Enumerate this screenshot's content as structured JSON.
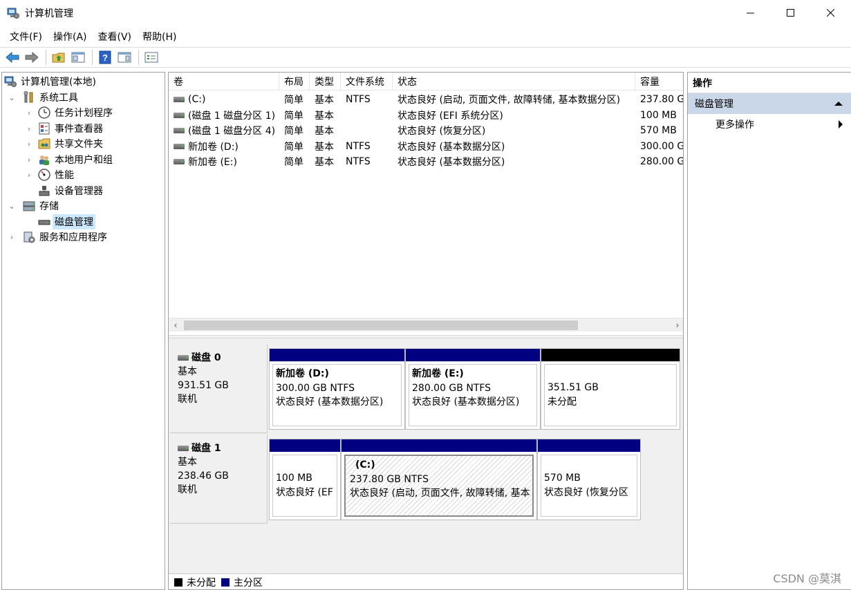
{
  "window": {
    "title": "计算机管理",
    "controls": [
      "minimize-icon",
      "maximize-icon",
      "close-icon"
    ]
  },
  "menu": [
    "文件(F)",
    "操作(A)",
    "查看(V)",
    "帮助(H)"
  ],
  "toolbar": {
    "buttons": [
      "back-arrow-icon",
      "forward-arrow-icon",
      "up-folder-icon",
      "show-hide-tree-icon",
      "help-icon",
      "action-pane-icon",
      "properties-icon"
    ]
  },
  "tree": {
    "root": "计算机管理(本地)",
    "system_tools": "系统工具",
    "task_scheduler": "任务计划程序",
    "event_viewer": "事件查看器",
    "shared_folders": "共享文件夹",
    "local_users": "本地用户和组",
    "performance": "性能",
    "device_manager": "设备管理器",
    "storage": "存储",
    "disk_management": "磁盘管理",
    "services": "服务和应用程序"
  },
  "volume_list": {
    "headers": [
      "卷",
      "布局",
      "类型",
      "文件系统",
      "状态",
      "容量"
    ],
    "rows": [
      [
        "(C:)",
        "简单",
        "基本",
        "NTFS",
        "状态良好 (启动, 页面文件, 故障转储, 基本数据分区)",
        "237.80 G"
      ],
      [
        "(磁盘 1 磁盘分区 1)",
        "简单",
        "基本",
        "",
        "状态良好 (EFI 系统分区)",
        "100 MB"
      ],
      [
        "(磁盘 1 磁盘分区 4)",
        "简单",
        "基本",
        "",
        "状态良好 (恢复分区)",
        "570 MB"
      ],
      [
        "新加卷 (D:)",
        "简单",
        "基本",
        "NTFS",
        "状态良好 (基本数据分区)",
        "300.00 G"
      ],
      [
        "新加卷 (E:)",
        "简单",
        "基本",
        "NTFS",
        "状态良好 (基本数据分区)",
        "280.00 G"
      ]
    ]
  },
  "disks": {
    "disk0": {
      "name": "磁盘 0",
      "type": "基本",
      "size": "931.51 GB",
      "status": "联机",
      "parts": [
        {
          "title": "新加卷 (D:)",
          "line1": "300.00 GB NTFS",
          "line2": "状态良好 (基本数据分区)",
          "color": "#000080"
        },
        {
          "title": "新加卷 (E:)",
          "line1": "280.00 GB NTFS",
          "line2": "状态良好 (基本数据分区)",
          "color": "#000080"
        },
        {
          "title": "",
          "line1": "351.51 GB",
          "line2": "未分配",
          "color": "#000000"
        }
      ]
    },
    "disk1": {
      "name": "磁盘 1",
      "type": "基本",
      "size": "238.46 GB",
      "status": "联机",
      "parts": [
        {
          "title": "",
          "line1": "100 MB",
          "line2": "状态良好 (EF",
          "color": "#000080"
        },
        {
          "title": "(C:)",
          "line1": "237.80 GB NTFS",
          "line2": "状态良好 (启动, 页面文件, 故障转储, 基本",
          "color": "#000080"
        },
        {
          "title": "",
          "line1": "570 MB",
          "line2": "状态良好 (恢复分区",
          "color": "#000080"
        }
      ]
    }
  },
  "legend": {
    "unallocated": "未分配",
    "primary": "主分区",
    "unallocated_color": "#000000",
    "primary_color": "#000080"
  },
  "actions": {
    "header": "操作",
    "section": "磁盘管理",
    "more": "更多操作"
  },
  "watermark": "CSDN @莫淇"
}
